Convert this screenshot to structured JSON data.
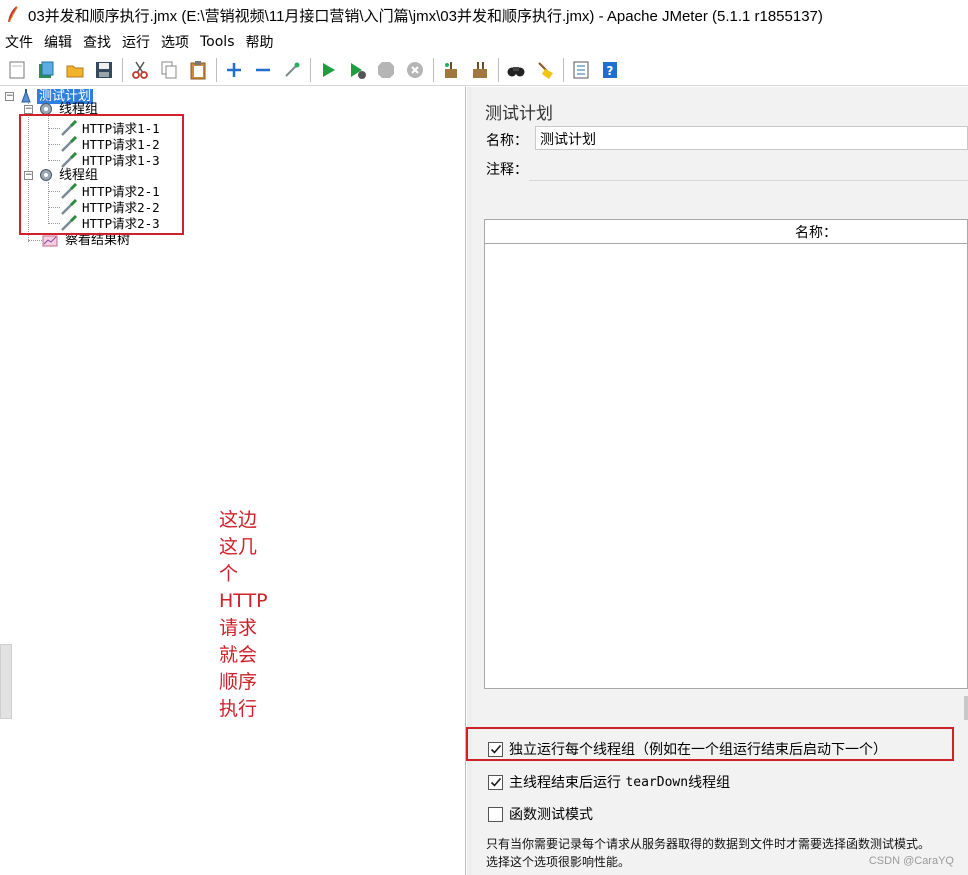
{
  "window": {
    "title": "03并发和顺序执行.jmx (E:\\营销视频\\11月接口营销\\入门篇\\jmx\\03并发和顺序执行.jmx) - Apache JMeter (5.1.1 r1855137)"
  },
  "menu": [
    "文件",
    "编辑",
    "查找",
    "运行",
    "选项",
    "Tools",
    "帮助"
  ],
  "toolbar": {
    "icons": [
      "new-icon",
      "templates-icon",
      "open-icon",
      "save-icon",
      "cut-icon",
      "copy-icon",
      "paste-icon",
      "expand-icon",
      "collapse-icon",
      "toggle-icon",
      "start-icon",
      "start-no-pause-icon",
      "stop-icon",
      "shutdown-icon",
      "clear-icon",
      "clear-all-icon",
      "search-icon",
      "reset-search-icon",
      "function-helper-icon",
      "help-icon"
    ]
  },
  "tree": {
    "root": "测试计划",
    "group1": "线程组",
    "group1_items": [
      "HTTP请求1-1",
      "HTTP请求1-2",
      "HTTP请求1-3"
    ],
    "group2": "线程组",
    "group2_items": [
      "HTTP请求2-1",
      "HTTP请求2-2",
      "HTTP请求2-3"
    ],
    "listener": "察看结果树"
  },
  "annotation": [
    "这边",
    "这几",
    "个",
    "HTTP",
    "请求",
    "就会",
    "顺序",
    "执行"
  ],
  "test_plan": {
    "heading": "测试计划",
    "name_label": "名称：",
    "name_value": "测试计划",
    "comment_label": "注释：",
    "table_header": "名称：",
    "option1_label": "独立运行每个线程组（例如在一个组运行结束后启动下一个）",
    "option1_checked": true,
    "option2_prefix": "主线程结束后运行 ",
    "option2_mono": "tearDown",
    "option2_suffix": "线程组",
    "option2_checked": true,
    "option3_label": "函数测试模式",
    "option3_checked": false,
    "note_line1": "只有当你需要记录每个请求从服务器取得的数据到文件时才需要选择函数测试模式。",
    "note_line2": "选择这个选项很影响性能。"
  },
  "watermark": "CSDN @CaraYQ",
  "colors": {
    "highlight_red": "#d0202a",
    "selection_blue": "#2d7fe0"
  }
}
